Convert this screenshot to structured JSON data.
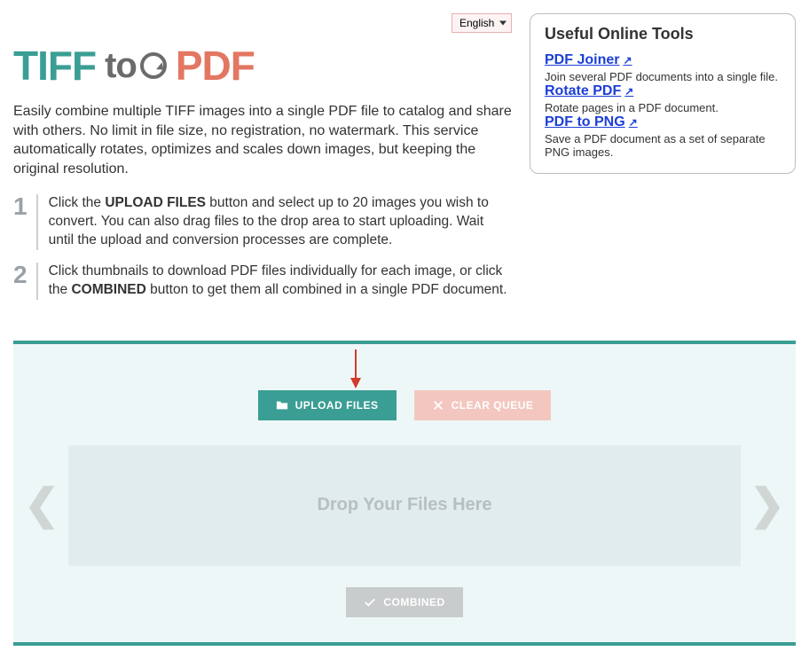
{
  "language": {
    "selected": "English"
  },
  "logo": {
    "tiff": "TIFF",
    "to": "to",
    "pdf": "PDF"
  },
  "intro": "Easily combine multiple TIFF images into a single PDF file to catalog and share with others. No limit in file size, no registration, no watermark. This service automatically rotates, optimizes and scales down images, but keeping the original resolution.",
  "steps": {
    "s1_num": "1",
    "s1_a": "Click the ",
    "s1_b": "UPLOAD FILES",
    "s1_c": " button and select up to 20 images you wish to convert. You can also drag files to the drop area to start uploading. Wait until the upload and conversion processes are complete.",
    "s2_num": "2",
    "s2_a": "Click thumbnails to download PDF files individually for each image, or click the ",
    "s2_b": "COMBINED",
    "s2_c": " button to get them all combined in a single PDF document."
  },
  "sidebar": {
    "title": "Useful Online Tools",
    "tools": [
      {
        "name": "PDF Joiner",
        "desc": "Join several PDF documents into a single file."
      },
      {
        "name": "Rotate PDF",
        "desc": "Rotate pages in a PDF document."
      },
      {
        "name": "PDF to PNG",
        "desc": "Save a PDF document as a set of separate PNG images."
      }
    ]
  },
  "buttons": {
    "upload": "UPLOAD FILES",
    "clear": "CLEAR QUEUE",
    "combined": "COMBINED"
  },
  "drop_text": "Drop Your Files Here"
}
